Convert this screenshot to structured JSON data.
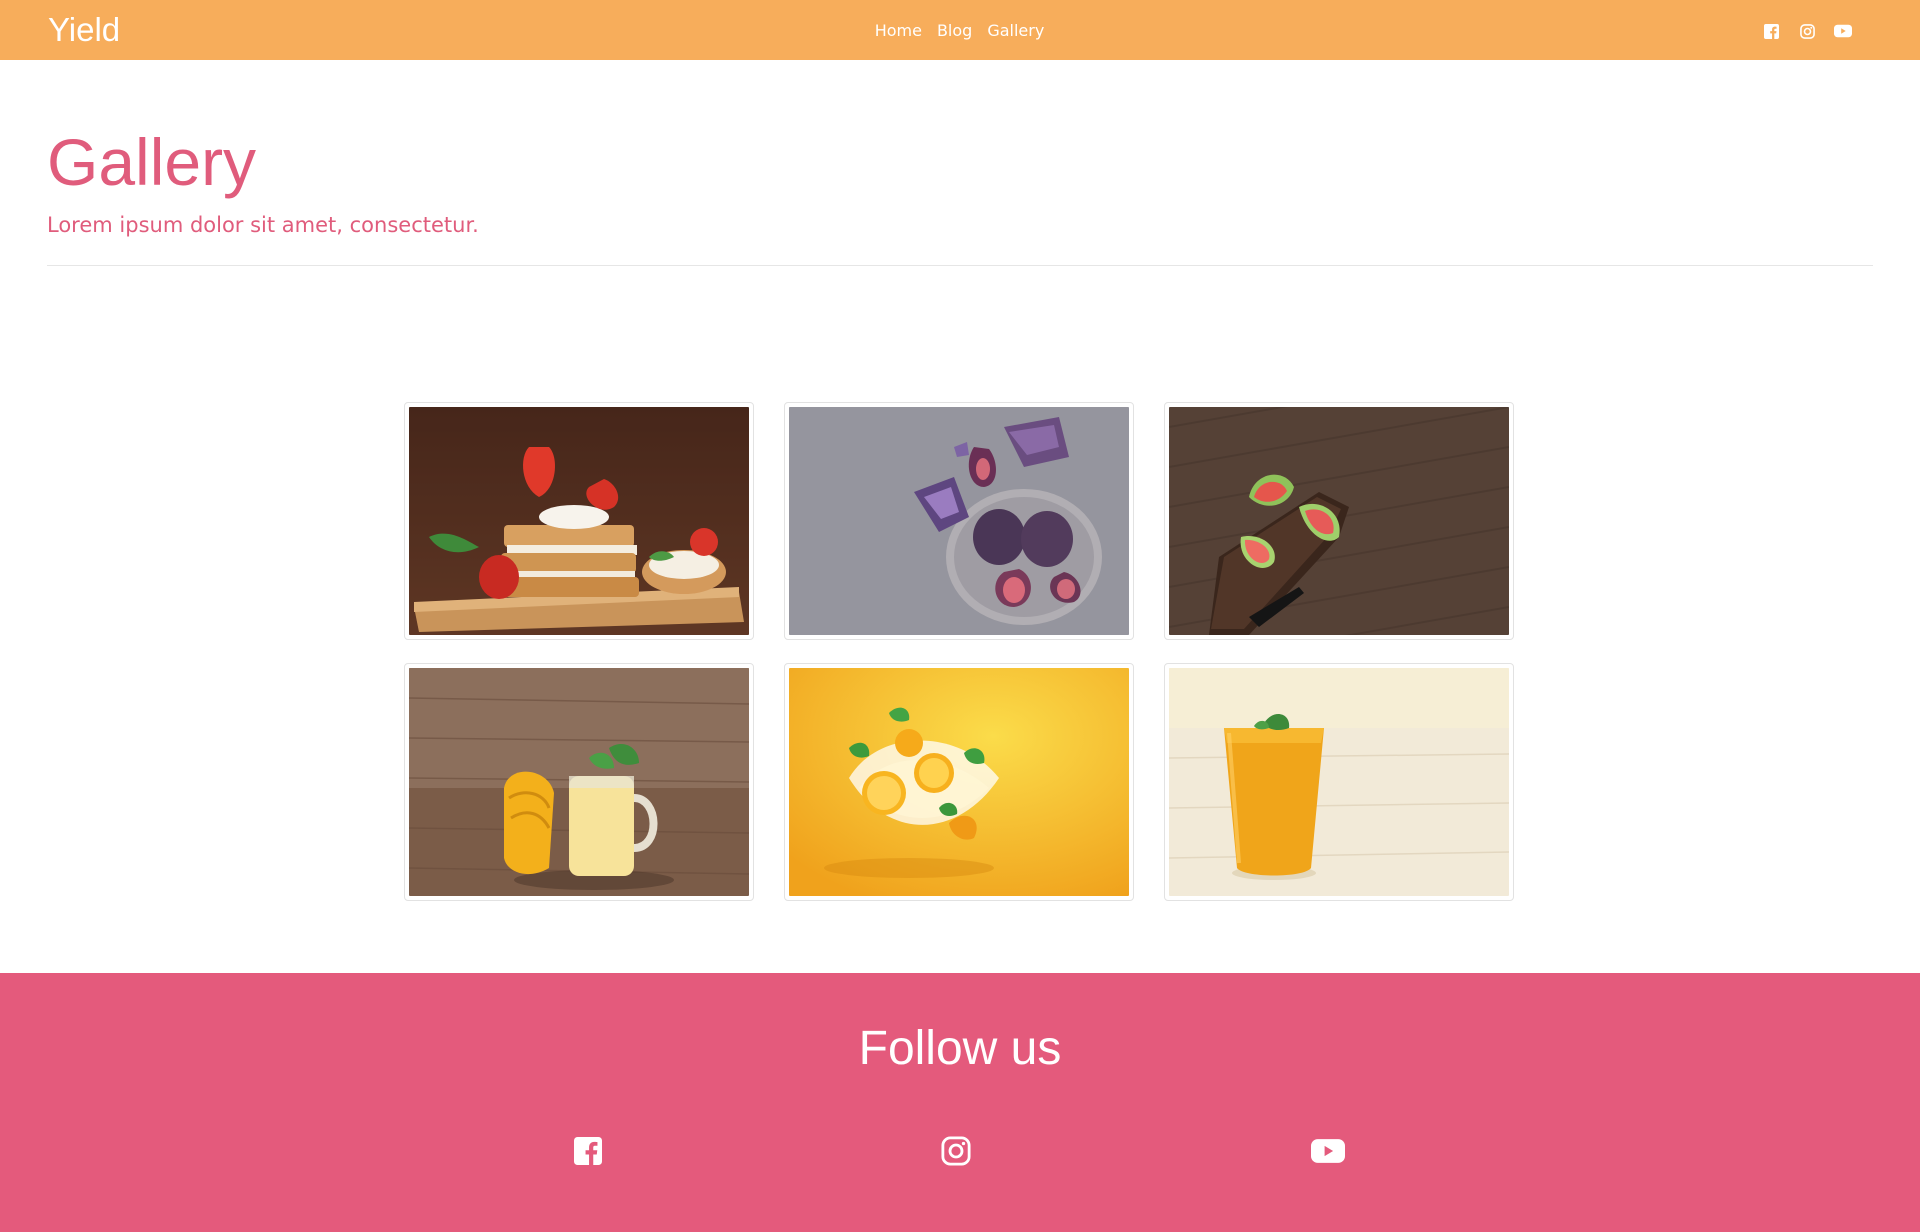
{
  "navbar": {
    "brand": "Yield",
    "links": [
      "Home",
      "Blog",
      "Gallery"
    ],
    "social_icons": [
      "facebook-icon",
      "instagram-icon",
      "youtube-icon"
    ],
    "background_color": "#f7ad5b"
  },
  "header": {
    "title": "Gallery",
    "subtitle": "Lorem ipsum dolor sit amet, consectetur.",
    "accent_color": "#e05c7c"
  },
  "gallery": {
    "images": [
      {
        "subject": "waffles with strawberries and cream"
      },
      {
        "subject": "figs and amethyst on stone"
      },
      {
        "subject": "guava on wooden board"
      },
      {
        "subject": "mango smoothie in jar"
      },
      {
        "subject": "orange splash on yellow"
      },
      {
        "subject": "orange smoothie glass"
      }
    ]
  },
  "footer": {
    "title": "Follow us",
    "social_icons": [
      "facebook-icon",
      "instagram-icon",
      "youtube-icon"
    ],
    "background_color": "#e45a7c"
  }
}
